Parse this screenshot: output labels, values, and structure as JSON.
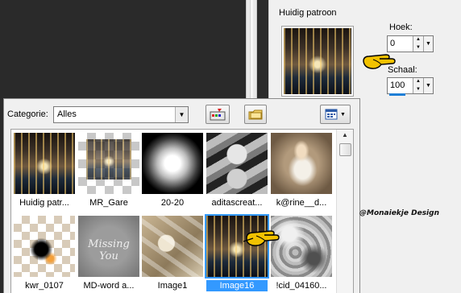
{
  "panel": {
    "title": "Huidig patroon",
    "hoek_label": "Hoek:",
    "hoek_value": "0",
    "schaal_label": "Schaal:",
    "schaal_value": "100"
  },
  "popup": {
    "category_label": "Categorie:",
    "category_value": "Alles"
  },
  "tiles": [
    {
      "caption": "Huidig patr..."
    },
    {
      "caption": "MR_Gare"
    },
    {
      "caption": "20-20"
    },
    {
      "caption": "aditascreat..."
    },
    {
      "caption": "k@rine__d..."
    },
    {
      "caption": "kwr_0107"
    },
    {
      "caption": "MD-word a..."
    },
    {
      "caption": "Image1"
    },
    {
      "caption": "Image16"
    },
    {
      "caption": "!cid_04160..."
    }
  ],
  "signature_text": "Missing You",
  "watermark": "@Monaiekje Design",
  "icons": {
    "dropdown_arrow": "▼",
    "spin_up": "▲",
    "spin_down": "▼",
    "scroll_up": "▲"
  },
  "colors": {
    "selection": "#3399ff",
    "pointer": "#f2c200"
  }
}
